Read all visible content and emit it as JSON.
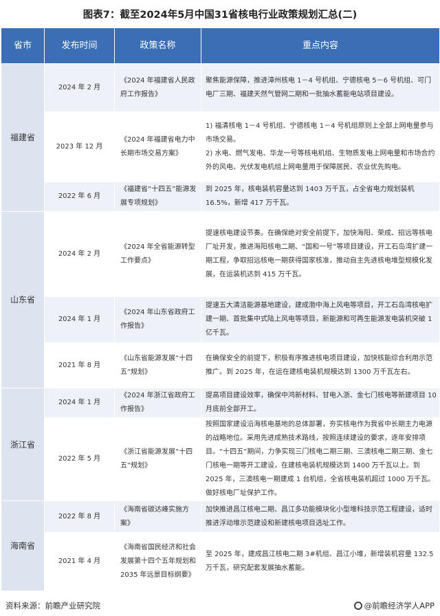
{
  "title": "图表7：截至2024年5月中国31省核电行业政策规划汇总(二)",
  "headers": [
    "省市",
    "发布时间",
    "政策名称",
    "重点内容"
  ],
  "groups": [
    {
      "province": "福建省",
      "rows": [
        {
          "date": "2024 年 2 月",
          "policy": "《2024 年福建省人民政府工作报告》",
          "points": [
            "聚焦能源保障，推进漳州核电 1－4 号机组、宁德核电 5－6 号机组、可门电厂三期、福建天然气管网二期和一批抽水蓄能电站项目建设。"
          ]
        },
        {
          "date": "2023 年 12 月",
          "policy": "《2024 年福建省电力中长期市场交易方案》",
          "points": [
            "1) 福清核电 1－4 号机组、宁德核电 1－4 号机组原则上全部上网电量参与市场交易。",
            "2) 水电、燃气发电、华龙一号等核电机组、生物质发电上网电量和市场合约外的风电、光伏发电机组上网电量用于保障居民、农业优先购电。"
          ]
        },
        {
          "date": "2022 年 6 月",
          "policy": "《福建省“十四五”能源发展专项规划》",
          "points": [
            "到 2025 年，核电装机容量达到 1403 万千瓦，占全省电力规划装机 16.5%，新增 417 万千瓦。"
          ]
        }
      ]
    },
    {
      "province": "山东省",
      "rows": [
        {
          "date": "2024 年 2 月",
          "policy": "《2024 年全省能源转型工作要点》",
          "points": [
            "提速核电建设节奏。在确保绝对安全前提下，加快海阳、荣成、招远等核电厂址开发，推进海阳核电二期、“国和一号”等项目建设，开工石岛湾扩建一期工程，争取招远核电一期获得国家核准，推动自主先进核电堆型规模化发展，在运装机达到 415 万千瓦。"
          ]
        },
        {
          "date": "2024 年 1 月",
          "policy": "《2024 年山东省政府工作报告》",
          "points": [
            "提速五大清洁能源基地建设，建成渤中海上风电等项目，开工石岛湾核电扩建一期、首批集中式陆上风电等项目，新能源和可再生能源发电装机突破 1 亿千瓦。"
          ]
        },
        {
          "date": "2021 年 8 月",
          "policy": "《山东省能源发展“十四五”规划》",
          "points": [
            "在确保安全的前提下，积极有序推进核电项目建设，加快核能综合利用示范推广。到 2025 年，在运在建核电装机规模达到 1300 万千瓦左右。"
          ]
        }
      ]
    },
    {
      "province": "浙江省",
      "rows": [
        {
          "date": "2024 年 1 月",
          "policy": "《2024 年浙江省政府工作报告》",
          "points": [
            "提高项目建设效率，确保中鸿新材料、甘电入浙、金七门核电等新建项目 10 月底前全部开工。"
          ]
        },
        {
          "date": "2022 年 5 月",
          "policy": "《浙江省能源发展“十四五”规划》",
          "points": [
            "按照国家建设沿海核电基地的总体部署，夯实核电作为我省中长期主力电源的战略地位。采用先进成熟技术路线，按照连续建设的要求，逐年安排项目。“十四五”期间，力争实现三门核电二期三期、三澳核电二期三期、金七门核电一期等开工建设，在建核电装机规模达到 1400 万千瓦以上。到 2025 年，三澳核电一期建成 1 台机组，全省核电装机超过 1000 万千瓦。做好核电厂址保护工作。"
          ]
        }
      ]
    },
    {
      "province": "海南省",
      "rows": [
        {
          "date": "2022 年 8 月",
          "policy": "《海南省碳达峰实施方案》",
          "points": [
            "加快推进昌江核电二期、昌江多功能模块化小型堆科技示范工程建设，适时推进浮动堆示范建设和新建核电项目选址工作。"
          ]
        },
        {
          "date": "2021 年 4 月",
          "policy": "《海南省国民经济和社会发展第十四个五年规划和 2035 年远景目标纲要》",
          "points": [
            "至 2025 年，建成昌江核电二期 3#机组、昌江小堆，新增装机容量 132.5 万千瓦，研究配套发展抽水蓄能。"
          ]
        }
      ]
    }
  ],
  "footer": {
    "source": "资料来源：前瞻产业研究院",
    "brand": "@前瞻经济学人APP",
    "brand_icon": "qianzhan-logo-icon"
  },
  "colors": {
    "header_bg": "#3a6fb5",
    "province_bg": "#dde4ef",
    "row_alt_bg": "#eef1f7"
  }
}
